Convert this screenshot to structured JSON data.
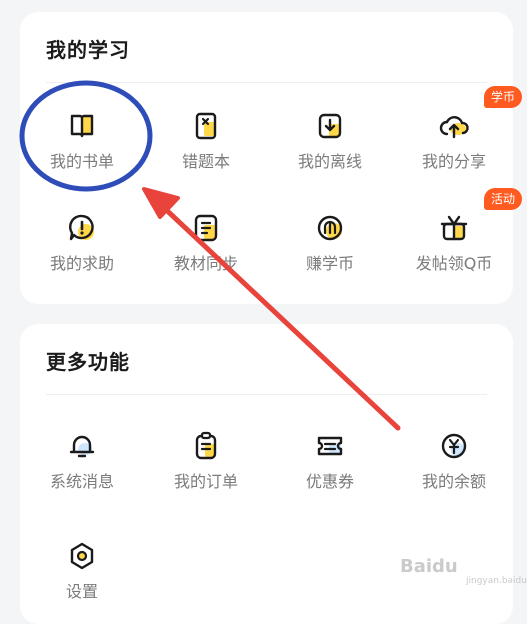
{
  "sections": {
    "study": {
      "title": "我的学习",
      "items": [
        {
          "label": "我的书单",
          "icon": "book-icon"
        },
        {
          "label": "错题本",
          "icon": "notebook-icon"
        },
        {
          "label": "我的离线",
          "icon": "download-icon"
        },
        {
          "label": "我的分享",
          "icon": "cloud-upload-icon",
          "badge": "学币"
        },
        {
          "label": "我的求助",
          "icon": "help-bubble-icon"
        },
        {
          "label": "教材同步",
          "icon": "textbook-icon"
        },
        {
          "label": "赚学币",
          "icon": "earn-coin-icon"
        },
        {
          "label": "发帖领Q币",
          "icon": "gift-icon",
          "badge": "活动"
        }
      ]
    },
    "more": {
      "title": "更多功能",
      "items": [
        {
          "label": "系统消息",
          "icon": "bell-icon"
        },
        {
          "label": "我的订单",
          "icon": "clipboard-icon"
        },
        {
          "label": "优惠券",
          "icon": "ticket-icon"
        },
        {
          "label": "我的余额",
          "icon": "yuan-coin-icon"
        },
        {
          "label": "设置",
          "icon": "gear-icon"
        }
      ]
    }
  },
  "colors": {
    "icon_stroke": "#1b1b1b",
    "accent_yellow": "#ffd84a",
    "accent_blue": "#cfe6ff",
    "badge": "#ff5a1f",
    "annotation": "#e8443c",
    "circle": "#2f4db8"
  },
  "watermark": {
    "logo": "Baidu",
    "sub": "jingyan.baidu.com"
  }
}
